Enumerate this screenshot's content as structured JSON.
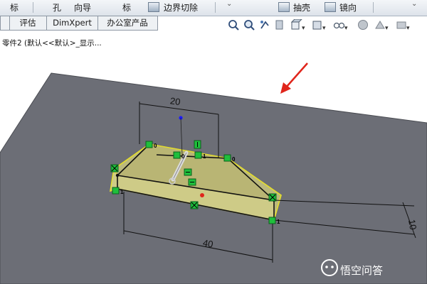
{
  "ribbon": {
    "partial_left_1": "标",
    "partial_left_2": "孔",
    "partial_left_3": "向导",
    "partial_left_4": "标",
    "boundary_cut": "边界切除",
    "shell": "抽壳",
    "mirror": "镜向"
  },
  "tabs": [
    "评估",
    "DimXpert",
    "办公室产品"
  ],
  "tree": {
    "part_label": "零件2 (默认<<默认>_显示..."
  },
  "sketch": {
    "dim_top": "20",
    "dim_bottom": "40",
    "dim_side": "10",
    "rel_zero": "0",
    "rel_one": "1"
  },
  "watermark": {
    "text": "悟空问答"
  },
  "colors": {
    "plane": "#6c6e76",
    "sketch_fill": "#c9c77e",
    "sketch_edge": "#e6df2a",
    "relation_green": "#1fbf3c",
    "arrow_red": "#e0251b"
  }
}
